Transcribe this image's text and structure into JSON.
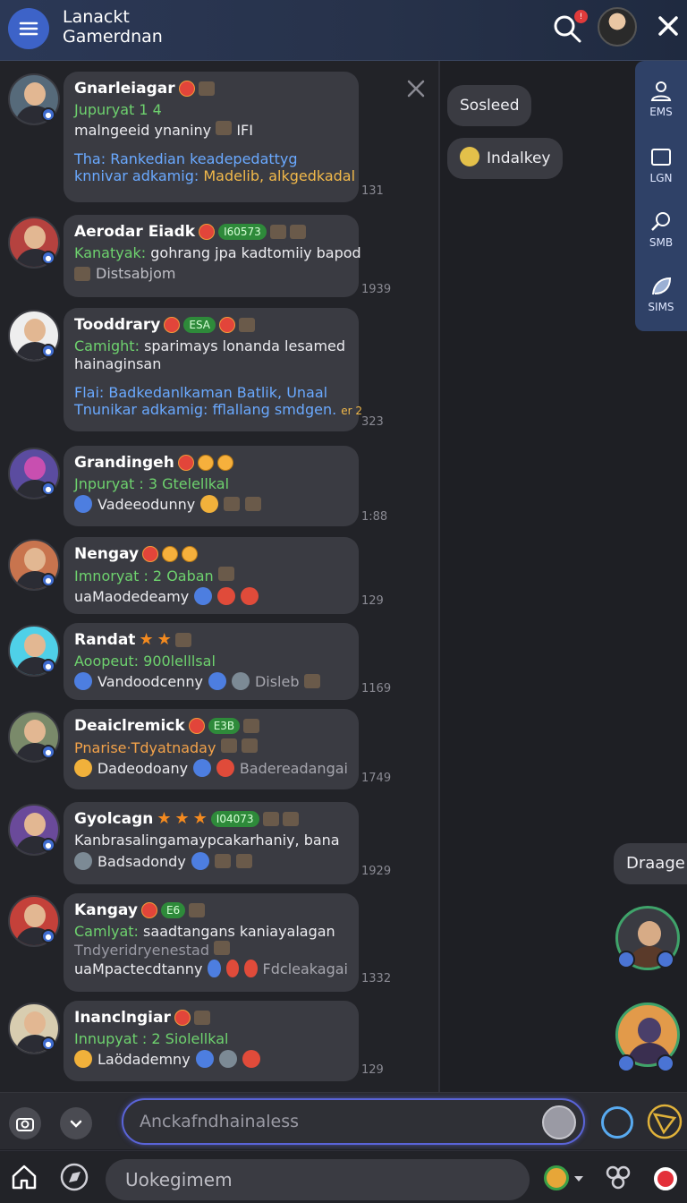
{
  "header": {
    "title_line1": "Lanackt",
    "title_line2": "Gamerdnan"
  },
  "messages": [
    {
      "name": "Gnarleiagar",
      "line1": "Jupuryat 1 4",
      "line2": "malngeeid ynaniny",
      "line2b": "IFI",
      "line3": "Tha: Rankedian keadepedattyg",
      "line4a": "knnivar adkamig:",
      "line4b": "Madelib, alkgedkadal",
      "time": "131"
    },
    {
      "name": "Aerodar Eiadk",
      "tag": "I60573",
      "line1a": "Kanatyak:",
      "line1b": "gohrang jpa kadtomiiy bapod",
      "line2": "Distsabjom",
      "time": "1939"
    },
    {
      "name": "Tooddrary",
      "tag": "ESA",
      "line1a": "Camight:",
      "line1b": "sparimays lonanda lesamed",
      "line2": "hainaginsan",
      "line3": "Flai: Badkedanlkaman Batlik, Unaal",
      "line4a": "Tnunikar adkamig: fflallang smdgen.",
      "line4b": "er 2",
      "time": "323"
    },
    {
      "name": "Grandingeh",
      "line1": "Jnpuryat : 3 Gtelellkal",
      "line2": "Vadeeodunny",
      "time": "1:88"
    },
    {
      "name": "Nengay",
      "line1": "Imnoryat : 2 Oaban",
      "line2": "uaMaodedeamy",
      "time": "129"
    },
    {
      "name": "Randat",
      "line1": "Aoopeut: 900lelllsal",
      "line2": "Vandoodcenny",
      "line2b": "Disleb",
      "time": "1169"
    },
    {
      "name": "Deaiclremick",
      "tag": "E3B",
      "line1": "Pnarise·Tdyatnaday",
      "line2": "Dadeodoany",
      "line2b": "Badereadangai",
      "time": "1749"
    },
    {
      "name": "Gyolcagn",
      "tag": "I04073",
      "line1": "Kanbrasalingamaypcakarhaniy, bana",
      "line2": "Badsadondy",
      "time": "1929"
    },
    {
      "name": "Kangay",
      "tag": "E6",
      "line1a": "Camlyat:",
      "line1b": "saadtangans kaniayalagan",
      "line2": "Tndyeridryenestad",
      "line3": "uaMpactecdtanny",
      "line3b": "Fdcleakagai",
      "time": "1332"
    },
    {
      "name": "Inanclngiar",
      "line1": "Innupyat : 2 Siolellkal",
      "line2": "Laödademny",
      "time": "129"
    }
  ],
  "right_panel": {
    "chips": [
      "Sosleed",
      "Indalkey"
    ],
    "tabs": [
      "EMS",
      "LGN",
      "SMB",
      "SIMS"
    ],
    "drag_label": "Draage"
  },
  "composer": {
    "placeholder": "Anckafndhainaless"
  },
  "bottom_bar": {
    "placeholder": "Uokegimem"
  },
  "colors": {
    "accent": "#3d63c8",
    "green_text": "#6ed26e",
    "blue_text": "#6aa9ff",
    "input_glow": "#5a64d8"
  }
}
